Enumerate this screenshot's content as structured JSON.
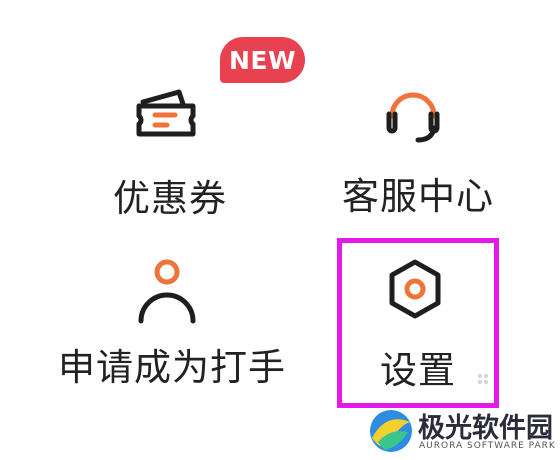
{
  "menu": {
    "items": [
      {
        "label": "优惠券",
        "icon": "coupon-ticket-icon",
        "badge": "NEW"
      },
      {
        "label": "客服中心",
        "icon": "customer-service-headset-icon"
      },
      {
        "label": "申请成为打手",
        "icon": "user-person-icon"
      },
      {
        "label": "设置",
        "icon": "settings-hexagon-icon"
      }
    ]
  },
  "colors": {
    "accent": "#f0743a",
    "icon_stroke": "#1e1e1e",
    "badge_bg": "#e8414f",
    "highlight_border": "#e21be8"
  },
  "watermark": {
    "title": "极光软件园",
    "subtitle": "AURORA SOFTWARE PARK"
  }
}
